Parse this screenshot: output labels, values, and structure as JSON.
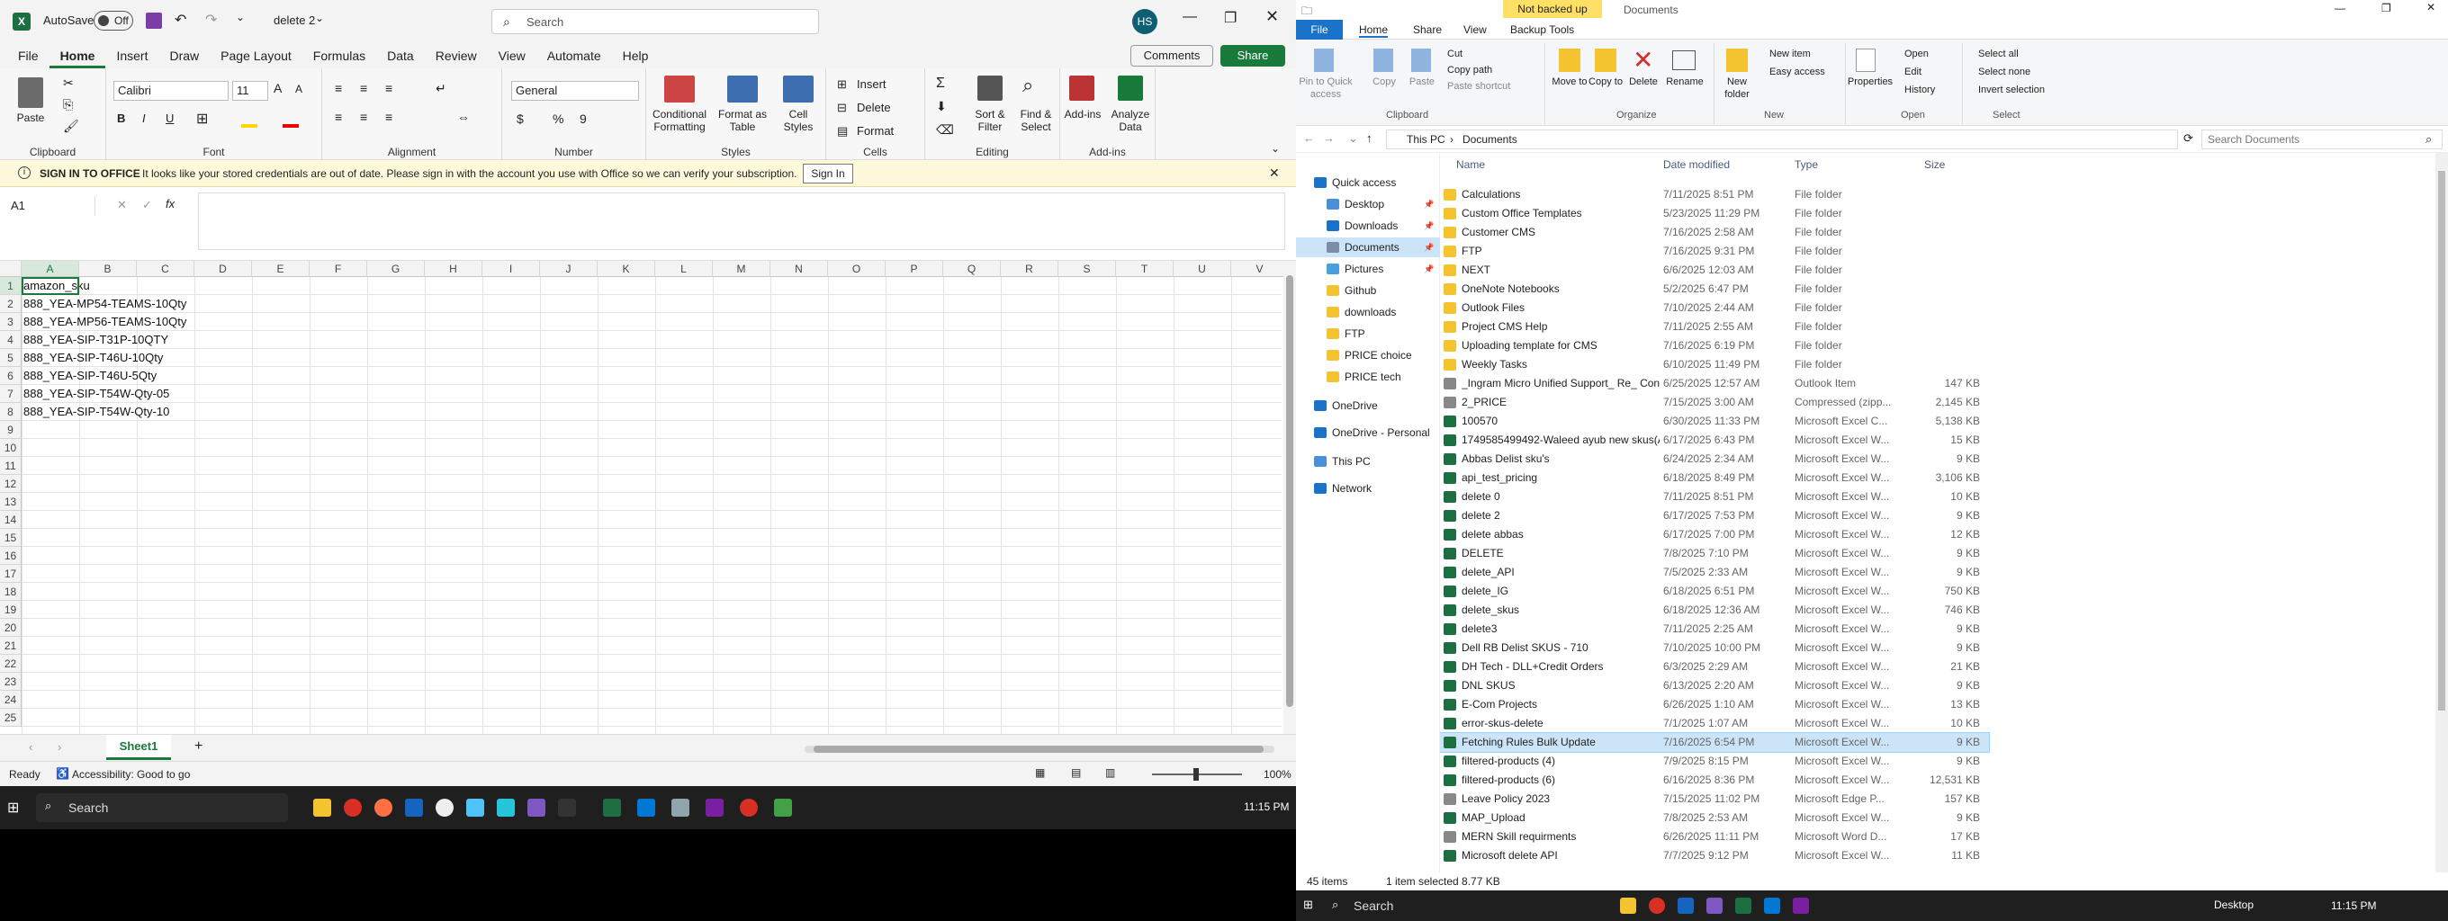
{
  "excel": {
    "title_bar": {
      "autosave": "AutoSave",
      "autosave_state": "Off",
      "doc_name": "delete 2",
      "search": "Search",
      "user_initials": "HS"
    },
    "menu_tabs": [
      "File",
      "Home",
      "Insert",
      "Draw",
      "Page Layout",
      "Formulas",
      "Data",
      "Review",
      "View",
      "Automate",
      "Help"
    ],
    "comments_label": "Comments",
    "share_label": "Share",
    "ribbon": {
      "clipboard": "Clipboard",
      "paste": "Paste",
      "font": "Font",
      "font_name": "Calibri",
      "font_size": "11",
      "alignment": "Alignment",
      "number": "Number",
      "number_format": "General",
      "styles": "Styles",
      "conditional": "Conditional Formatting",
      "format_table": "Format as Table",
      "cell_styles": "Cell Styles",
      "cells": "Cells",
      "insert": "Insert",
      "delete": "Delete",
      "format": "Format",
      "editing": "Editing",
      "sort_filter": "Sort & Filter",
      "find_select": "Find & Select",
      "addins": "Add-ins",
      "analyze": "Analyze Data"
    },
    "info_bar": {
      "title": "SIGN IN TO OFFICE",
      "message": "It looks like your stored credentials are out of date. Please sign in with the account you use with Office so we can verify your subscription.",
      "button": "Sign In"
    },
    "name_box": "A1",
    "columns": [
      "A",
      "B",
      "C",
      "D",
      "E",
      "F",
      "G",
      "H",
      "I",
      "J",
      "K",
      "L",
      "M",
      "N",
      "O",
      "P",
      "Q",
      "R",
      "S",
      "T",
      "U",
      "V"
    ],
    "rows": [
      "1",
      "2",
      "3",
      "4",
      "5",
      "6",
      "7",
      "8",
      "9",
      "10",
      "11",
      "12",
      "13",
      "14",
      "15",
      "16",
      "17",
      "18",
      "19",
      "20",
      "21",
      "22",
      "23",
      "24",
      "25"
    ],
    "cells": [
      "amazon_sku",
      "888_YEA-MP54-TEAMS-10Qty",
      "888_YEA-MP56-TEAMS-10Qty",
      "888_YEA-SIP-T31P-10QTY",
      "888_YEA-SIP-T46U-10Qty",
      "888_YEA-SIP-T46U-5Qty",
      "888_YEA-SIP-T54W-Qty-05",
      "888_YEA-SIP-T54W-Qty-10"
    ],
    "sheet_tab": "Sheet1",
    "status": {
      "ready": "Ready",
      "accessibility": "Accessibility: Good to go",
      "zoom": "100%"
    },
    "taskbar": {
      "search": "Search",
      "time": "11:15 PM"
    }
  },
  "explorer": {
    "title": "Documents",
    "badge": "Not backed up",
    "tool_tab": "Backup Tools",
    "tabs": [
      "File",
      "Home",
      "Share",
      "View"
    ],
    "ribbon": {
      "pin": "Pin to Quick access",
      "copy": "Copy",
      "paste": "Paste",
      "cut": "Cut",
      "copy_path": "Copy path",
      "paste_shortcut": "Paste shortcut",
      "clipboard": "Clipboard",
      "move_to": "Move to",
      "copy_to": "Copy to",
      "delete": "Delete",
      "rename": "Rename",
      "organize": "Organize",
      "new_folder": "New folder",
      "new_item": "New item",
      "easy_access": "Easy access",
      "new": "New",
      "properties": "Properties",
      "open": "Open",
      "edit": "Edit",
      "history": "History",
      "open_grp": "Open",
      "select_all": "Select all",
      "select_none": "Select none",
      "invert": "Invert selection",
      "select": "Select"
    },
    "path": [
      "This PC",
      "Documents"
    ],
    "search": "Search Documents",
    "nav": [
      "Quick access",
      "Desktop",
      "Downloads",
      "Documents",
      "Pictures",
      "Github",
      "downloads",
      "FTP",
      "PRICE choice",
      "PRICE tech",
      "OneDrive",
      "OneDrive - Personal",
      "This PC",
      "Network"
    ],
    "headers": [
      "Name",
      "Date modified",
      "Type",
      "Size"
    ],
    "files": [
      [
        "Calculations",
        "7/11/2025 8:51 PM",
        "File folder",
        ""
      ],
      [
        "Custom Office Templates",
        "5/23/2025 11:29 PM",
        "File folder",
        ""
      ],
      [
        "Customer CMS",
        "7/16/2025 2:58 AM",
        "File folder",
        ""
      ],
      [
        "FTP",
        "7/16/2025 9:31 PM",
        "File folder",
        ""
      ],
      [
        "NEXT",
        "6/6/2025 12:03 AM",
        "File folder",
        ""
      ],
      [
        "OneNote Notebooks",
        "5/2/2025 6:47 PM",
        "File folder",
        ""
      ],
      [
        "Outlook Files",
        "7/10/2025 2:44 AM",
        "File folder",
        ""
      ],
      [
        "Project CMS Help",
        "7/11/2025 2:55 AM",
        "File folder",
        ""
      ],
      [
        "Uploading template for CMS",
        "7/16/2025 6:19 PM",
        "File folder",
        ""
      ],
      [
        "Weekly Tasks",
        "6/10/2025 11:49 PM",
        "File folder",
        ""
      ],
      [
        "_Ingram Micro Unified Support_ Re_ Con...",
        "6/25/2025 12:57 AM",
        "Outlook Item",
        "147 KB"
      ],
      [
        "2_PRICE",
        "7/15/2025 3:00 AM",
        "Compressed (zipp...",
        "2,145 KB"
      ],
      [
        "100570",
        "6/30/2025 11:33 PM",
        "Microsoft Excel C...",
        "5,138 KB"
      ],
      [
        "1749585499492-Waleed ayub new skus(A...",
        "6/17/2025 6:43 PM",
        "Microsoft Excel W...",
        "15 KB"
      ],
      [
        "Abbas Delist sku's",
        "6/24/2025 2:34 AM",
        "Microsoft Excel W...",
        "9 KB"
      ],
      [
        "api_test_pricing",
        "6/18/2025 8:49 PM",
        "Microsoft Excel W...",
        "3,106 KB"
      ],
      [
        "delete 0",
        "7/11/2025 8:51 PM",
        "Microsoft Excel W...",
        "10 KB"
      ],
      [
        "delete 2",
        "6/17/2025 7:53 PM",
        "Microsoft Excel W...",
        "9 KB"
      ],
      [
        "delete abbas",
        "6/17/2025 7:00 PM",
        "Microsoft Excel W...",
        "12 KB"
      ],
      [
        "DELETE",
        "7/8/2025 7:10 PM",
        "Microsoft Excel W...",
        "9 KB"
      ],
      [
        "delete_API",
        "7/5/2025 2:33 AM",
        "Microsoft Excel W...",
        "9 KB"
      ],
      [
        "delete_IG",
        "6/18/2025 6:51 PM",
        "Microsoft Excel W...",
        "750 KB"
      ],
      [
        "delete_skus",
        "6/18/2025 12:36 AM",
        "Microsoft Excel W...",
        "746 KB"
      ],
      [
        "delete3",
        "7/11/2025 2:25 AM",
        "Microsoft Excel W...",
        "9 KB"
      ],
      [
        "Dell RB Delist SKUS - 710",
        "7/10/2025 10:00 PM",
        "Microsoft Excel W...",
        "9 KB"
      ],
      [
        "DH Tech - DLL+Credit Orders",
        "6/3/2025 2:29 AM",
        "Microsoft Excel W...",
        "21 KB"
      ],
      [
        "DNL SKUS",
        "6/13/2025 2:20 AM",
        "Microsoft Excel W...",
        "9 KB"
      ],
      [
        "E-Com Projects",
        "6/26/2025 1:10 AM",
        "Microsoft Excel W...",
        "13 KB"
      ],
      [
        "error-skus-delete",
        "7/1/2025 1:07 AM",
        "Microsoft Excel W...",
        "10 KB"
      ],
      [
        "Fetching Rules Bulk Update",
        "7/16/2025 6:54 PM",
        "Microsoft Excel W...",
        "9 KB"
      ],
      [
        "filtered-products (4)",
        "7/9/2025 8:15 PM",
        "Microsoft Excel W...",
        "9 KB"
      ],
      [
        "filtered-products (6)",
        "6/16/2025 8:36 PM",
        "Microsoft Excel W...",
        "12,531 KB"
      ],
      [
        "Leave Policy 2023",
        "7/15/2025 11:02 PM",
        "Microsoft Edge P...",
        "157 KB"
      ],
      [
        "MAP_Upload",
        "7/8/2025 2:53 AM",
        "Microsoft Excel W...",
        "9 KB"
      ],
      [
        "MERN Skill requirments",
        "6/26/2025 11:11 PM",
        "Microsoft Word D...",
        "17 KB"
      ],
      [
        "Microsoft delete API",
        "7/7/2025 9:12 PM",
        "Microsoft Excel W...",
        "11 KB"
      ]
    ],
    "status": {
      "count": "45 items",
      "selected": "1 item selected  8.77 KB"
    },
    "taskbar": {
      "search": "Search",
      "desktop": "Desktop",
      "time": "11:15 PM"
    }
  }
}
